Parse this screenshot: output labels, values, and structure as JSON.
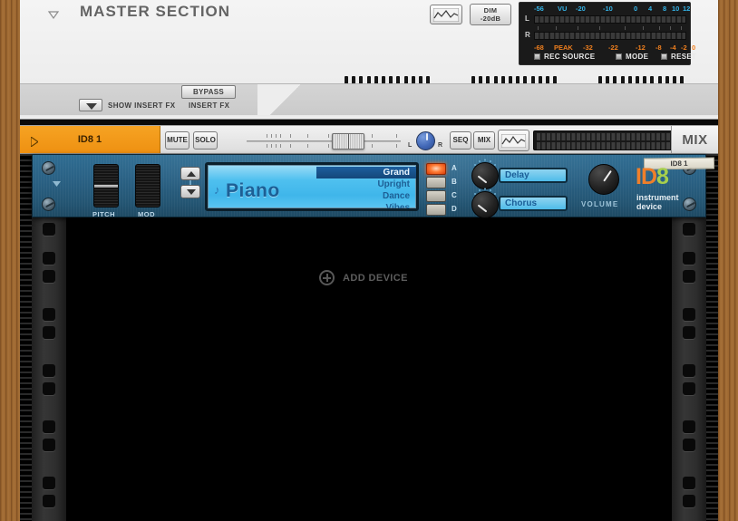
{
  "master": {
    "title": "MASTER SECTION",
    "disclosure_icon": "triangle-down-icon",
    "wave_button_icon": "waveform-icon",
    "dim_button": {
      "line1": "DIM",
      "line2": "-20dB"
    },
    "vu": {
      "top_scale": [
        "-56",
        "VU",
        "-20",
        "-10",
        "0",
        "4",
        "8",
        "10",
        "12"
      ],
      "bottom_scale": [
        "-68",
        "PEAK",
        "-32",
        "-22",
        "-12",
        "-8",
        "-4",
        "-2",
        "0"
      ],
      "channels": [
        "L",
        "R"
      ],
      "options": [
        "REC SOURCE",
        "MODE",
        "RESET"
      ],
      "top_color": "#34b4e8",
      "bottom_color": "#ef7f1e"
    },
    "insert_bar": {
      "show_insert_fx_label": "SHOW INSERT FX",
      "disclosure_icon": "triangle-down-icon",
      "bypass_label": "BYPASS",
      "insert_fx_label": "INSERT FX"
    }
  },
  "track": {
    "name": "ID8 1",
    "play_icon": "play-triangle-icon",
    "mute_label": "MUTE",
    "solo_label": "SOLO",
    "pan_left_label": "L",
    "pan_right_label": "R",
    "seq_label": "SEQ",
    "mix_label": "MIX",
    "wave_icon": "waveform-icon",
    "mix_tab_label": "MIX",
    "header_color": "#f6a323"
  },
  "device": {
    "name_tag": "ID8 1",
    "logo_id": "ID",
    "logo_eight": "8",
    "logo_subtitle": "instrument device",
    "logo_orange": "#ef7f2a",
    "logo_green": "#a7cf4c",
    "panel_color": "#2a6184",
    "pitch_label": "PITCH",
    "mod_label": "MOD",
    "volume_label": "VOLUME",
    "lcd": {
      "instrument": "Piano",
      "note_icon": "music-note-icon",
      "presets": [
        {
          "label": "Grand",
          "selected": true
        },
        {
          "label": "Upright",
          "selected": false
        },
        {
          "label": "Dance",
          "selected": false
        },
        {
          "label": "Vibes",
          "selected": false
        }
      ]
    },
    "banks": [
      {
        "label": "A",
        "on": true
      },
      {
        "label": "B",
        "on": false
      },
      {
        "label": "C",
        "on": false
      },
      {
        "label": "D",
        "on": false
      }
    ],
    "fx_slots": [
      "Delay",
      "Chorus"
    ],
    "up_icon": "triangle-up-icon",
    "down_icon": "triangle-down-icon"
  },
  "rack": {
    "add_device_label": "ADD DEVICE",
    "add_device_icon": "plus-circle-icon"
  }
}
